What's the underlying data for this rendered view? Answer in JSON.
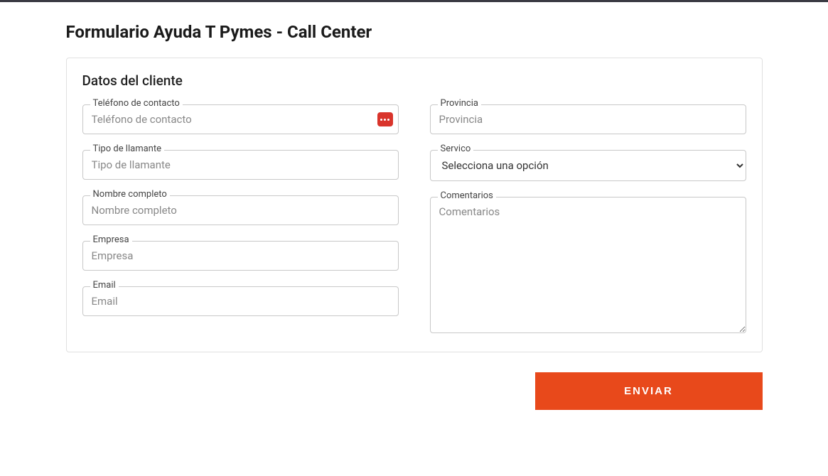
{
  "page": {
    "title": "Formulario Ayuda T Pymes - Call Center"
  },
  "section": {
    "title": "Datos del cliente"
  },
  "fields": {
    "telefono": {
      "label": "Teléfono de contacto",
      "placeholder": "Teléfono de contacto",
      "value": ""
    },
    "tipo_llamante": {
      "label": "Tipo de llamante",
      "placeholder": "Tipo de llamante",
      "value": ""
    },
    "nombre": {
      "label": "Nombre completo",
      "placeholder": "Nombre completo",
      "value": ""
    },
    "empresa": {
      "label": "Empresa",
      "placeholder": "Empresa",
      "value": ""
    },
    "email": {
      "label": "Email",
      "placeholder": "Email",
      "value": ""
    },
    "provincia": {
      "label": "Provincia",
      "placeholder": "Provincia",
      "value": ""
    },
    "servicio": {
      "label": "Servico",
      "selected": "Selecciona una opción"
    },
    "comentarios": {
      "label": "Comentarios",
      "placeholder": "Comentarios",
      "value": ""
    }
  },
  "actions": {
    "submit": "ENVIAR"
  },
  "icons": {
    "lastpass": "lastpass-icon"
  }
}
